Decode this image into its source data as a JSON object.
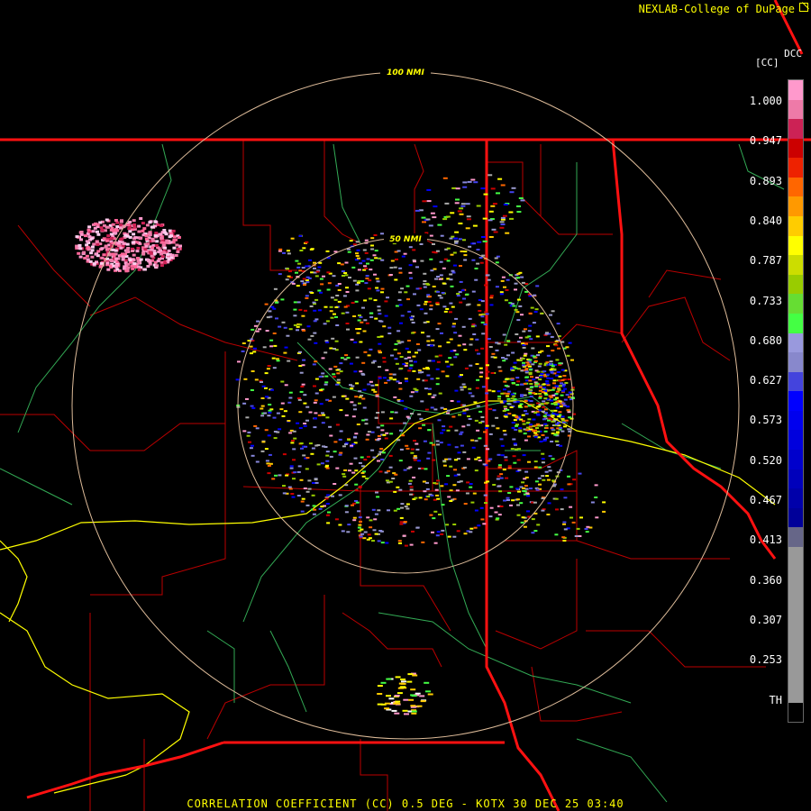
{
  "header": {
    "credit": "NEXLAB-College of DuPage",
    "dcc": "DCC"
  },
  "legend": {
    "unit": "[CC]",
    "ticks": [
      "1.000",
      "0.947",
      "0.893",
      "0.840",
      "0.787",
      "0.733",
      "0.680",
      "0.627",
      "0.573",
      "0.520",
      "0.467",
      "0.413",
      "0.360",
      "0.307",
      "0.253",
      "TH"
    ],
    "colors": [
      "#ff99cc",
      "#ee7aa8",
      "#cc2255",
      "#cc0000",
      "#ee2200",
      "#ff6600",
      "#ff9900",
      "#ffcc00",
      "#ffff00",
      "#ccdd00",
      "#99cc00",
      "#66dd33",
      "#44ff44",
      "#9999dd",
      "#8888cc",
      "#4444dd",
      "#0000ff",
      "#0000ee",
      "#0000dd",
      "#0000cc",
      "#0000bb",
      "#0000aa",
      "#000099",
      "#666688",
      "#999999",
      "#999999",
      "#999999",
      "#999999",
      "#999999",
      "#999999",
      "#999999",
      "#999999",
      "#000000"
    ]
  },
  "rings": {
    "inner_label": "50 NMI",
    "outer_label": "100 NMI"
  },
  "footer": "CORRELATION COEFFICIENT (CC) 0.5 DEG - KOTX 30 DEC 25 03:40"
}
